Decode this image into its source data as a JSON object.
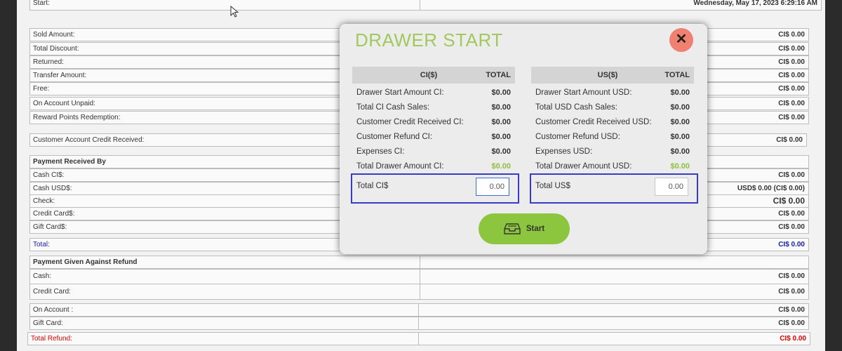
{
  "report": {
    "start": {
      "label": "Start:",
      "value": "Wednesday, May 17, 2023 6:29:16 AM"
    },
    "sold_amount": {
      "label": "Sold Amount:",
      "value": "CI$ 0.00"
    },
    "total_discount": {
      "label": "Total Discount:",
      "value": "CI$ 0.00"
    },
    "returned": {
      "label": "Returned:",
      "value": "CI$ 0.00"
    },
    "transfer_amount": {
      "label": "Transfer Amount:",
      "value": "CI$ 0.00"
    },
    "free": {
      "label": "Free:",
      "value": "CI$ 0.00"
    },
    "on_account_unpaid": {
      "label": "On Account Unpaid:",
      "value": "CI$ 0.00"
    },
    "reward_points": {
      "label": "Reward Points Redemption:",
      "value": "CI$ 0.00"
    },
    "customer_account_credit": {
      "label": "Customer Account Credit Received:",
      "value": "CI$ 0.00"
    },
    "payment_received_header": "Payment Received By",
    "cash_ci": {
      "label": "Cash CI$:",
      "value": "CI$ 0.00"
    },
    "cash_usd": {
      "label": "Cash USD$:",
      "value": "USD$ 0.00 (CI$ 0.00)"
    },
    "check": {
      "label": "Check:",
      "value": "CI$ 0.00"
    },
    "credit_card": {
      "label": "Credit Card$:",
      "value": "CI$ 0.00"
    },
    "gift_card": {
      "label": "Gift Card$:",
      "value": "CI$ 0.00"
    },
    "total": {
      "label": "Total:",
      "value": "CI$ 0.00"
    },
    "refund_header": "Payment Given Against Refund",
    "refund_cash": {
      "label": "Cash:",
      "value": "CI$ 0.00"
    },
    "refund_credit_card": {
      "label": "Credit Card:",
      "value": "CI$ 0.00"
    },
    "refund_on_account": {
      "label": "On Account :",
      "value": "CI$ 0.00"
    },
    "refund_gift_card": {
      "label": "Gift Card:",
      "value": "CI$ 0.00"
    },
    "total_refund": {
      "label": "Total Refund:",
      "value": "CI$ 0.00"
    }
  },
  "modal": {
    "title": "DRAWER START",
    "close_symbol": "✕",
    "left": {
      "head_currency": "CI($)",
      "head_total": "TOTAL",
      "lines": [
        {
          "label": "Drawer Start Amount CI:",
          "value": "$0.00"
        },
        {
          "label": "Total CI Cash Sales:",
          "value": "$0.00"
        },
        {
          "label": "Customer Credit Received CI:",
          "value": "$0.00"
        },
        {
          "label": "Customer Refund CI:",
          "value": "$0.00"
        },
        {
          "label": "Expenses CI:",
          "value": "$0.00"
        },
        {
          "label": "Total Drawer Amount CI:",
          "value": "$0.00"
        }
      ],
      "total_label": "Total CI$",
      "total_input": "0.00"
    },
    "right": {
      "head_currency": "US($)",
      "head_total": "TOTAL",
      "lines": [
        {
          "label": "Drawer Start Amount USD:",
          "value": "$0.00"
        },
        {
          "label": "Total USD Cash Sales:",
          "value": "$0.00"
        },
        {
          "label": "Customer Credit Received USD:",
          "value": "$0.00"
        },
        {
          "label": "Customer Refund USD:",
          "value": "$0.00"
        },
        {
          "label": "Expenses USD:",
          "value": "$0.00"
        },
        {
          "label": "Total Drawer Amount USD:",
          "value": "$0.00"
        }
      ],
      "total_label": "Total US$",
      "total_input": "0.00"
    },
    "start_label": "Start",
    "start_icon": "drawer-icon"
  },
  "colors": {
    "accent_green": "#8cc63f",
    "title_green": "#a2c95c",
    "close_red": "#f08070",
    "focus_blue": "#3a3ac8"
  }
}
